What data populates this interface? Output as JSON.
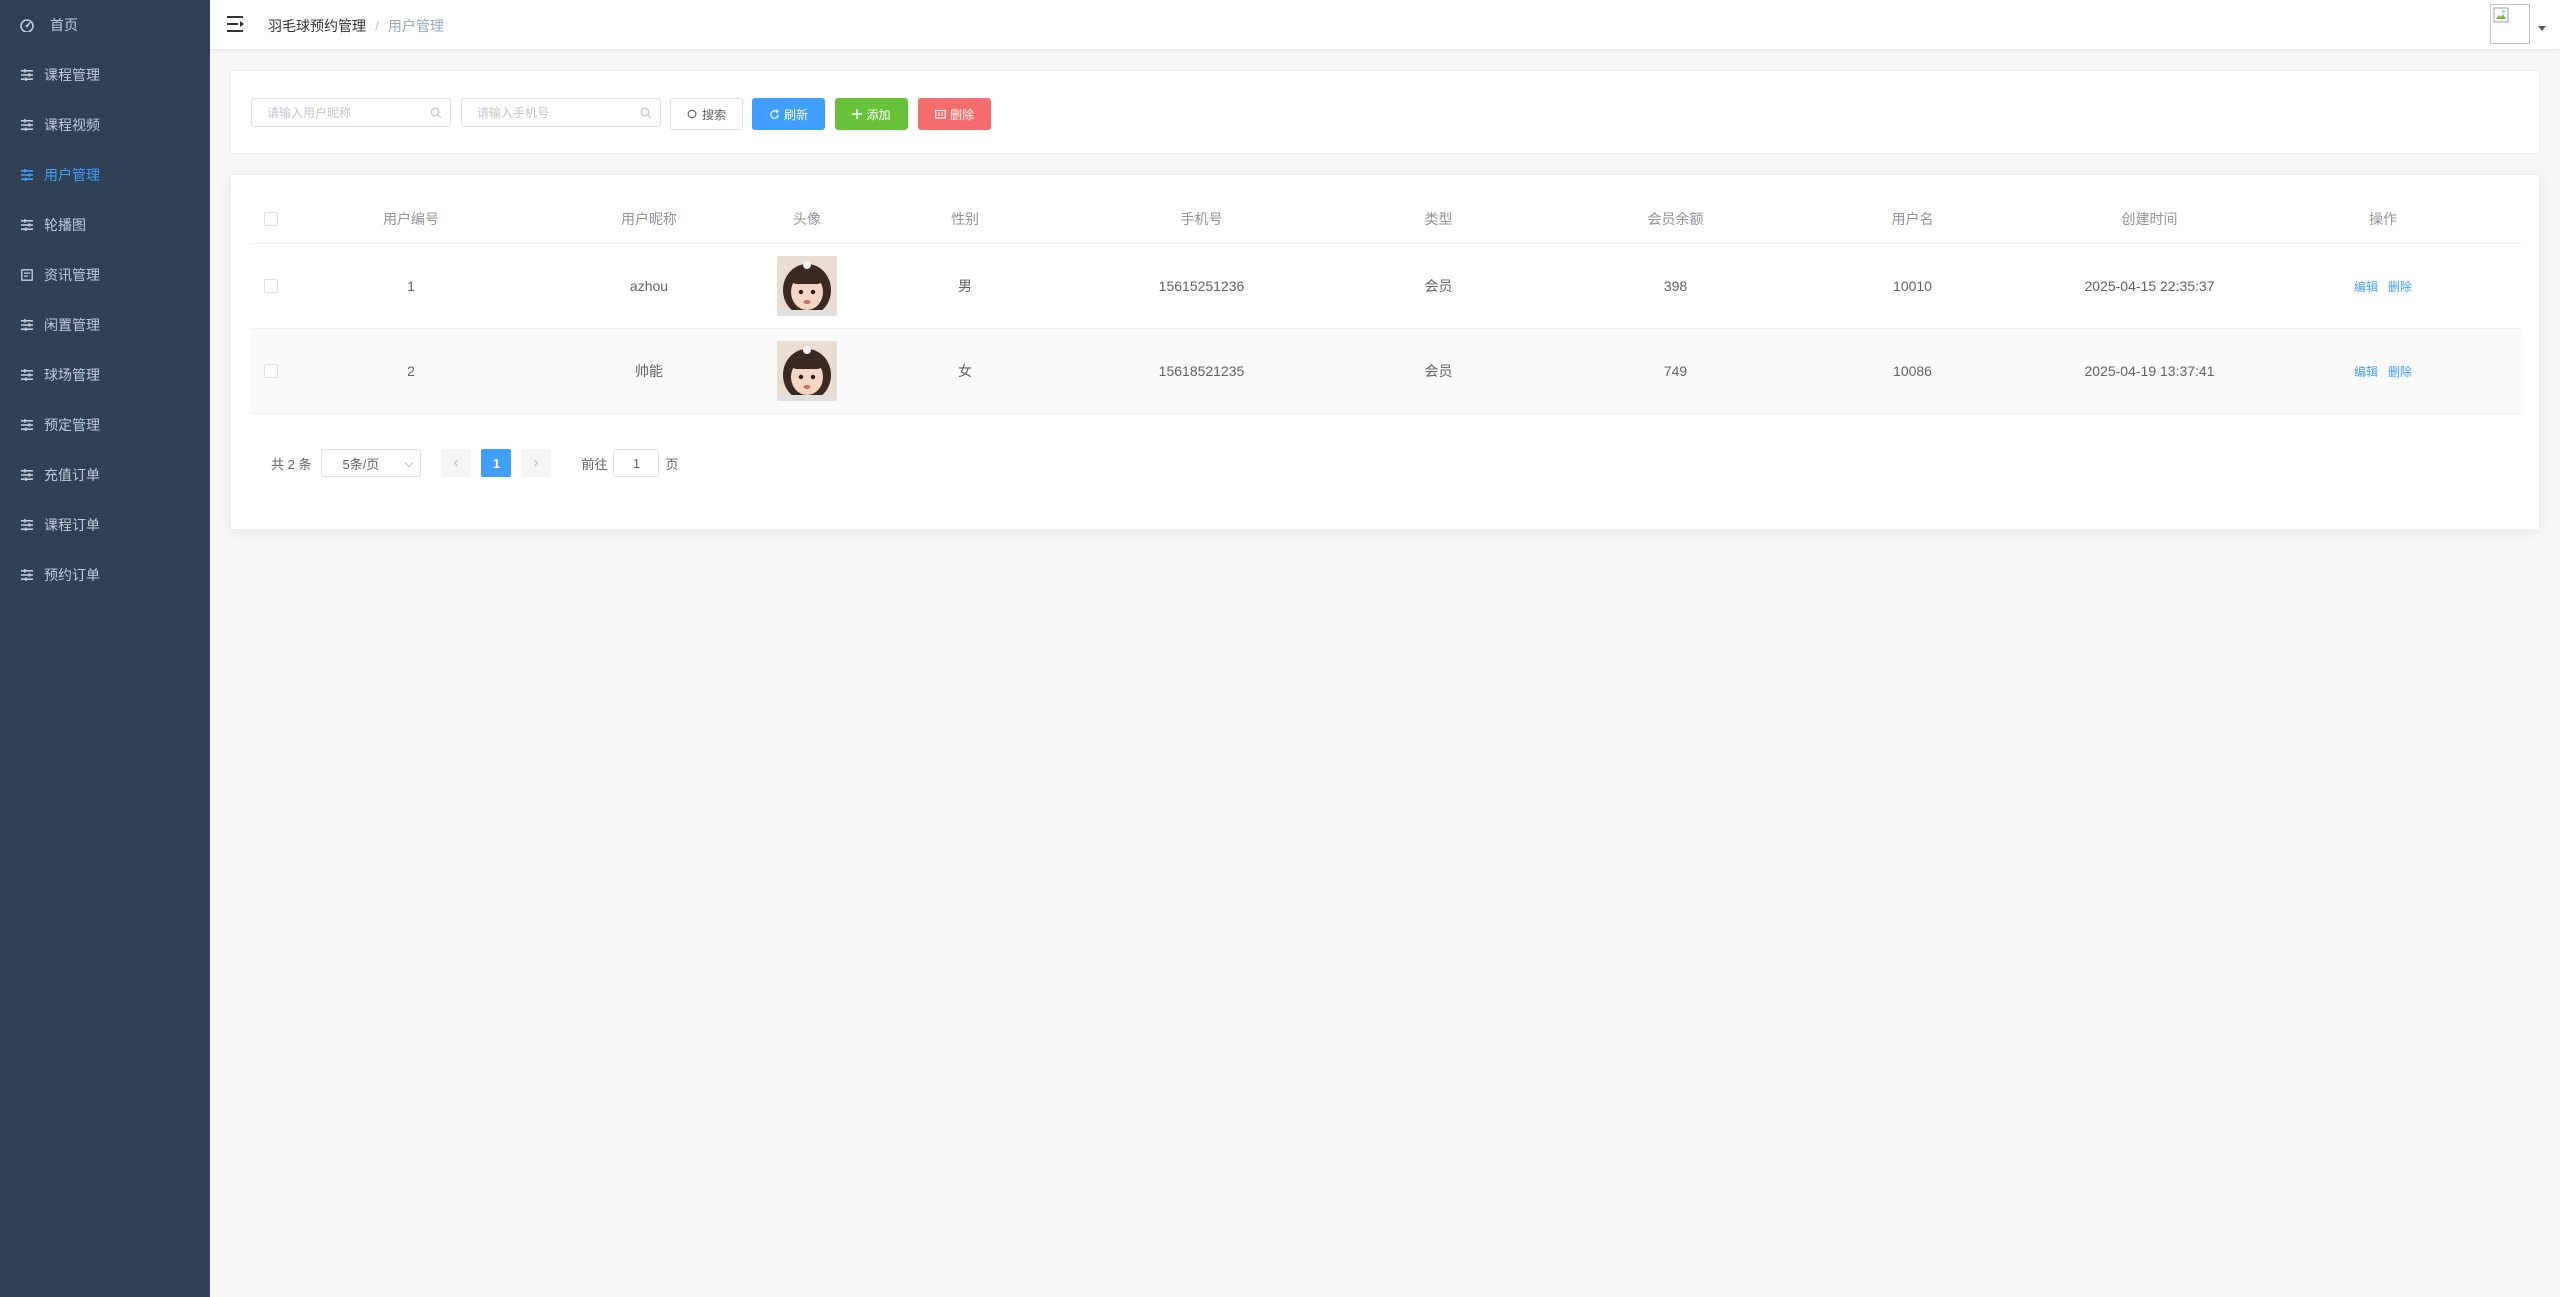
{
  "sidebar": {
    "items": [
      {
        "label": "首页",
        "icon": "dashboard-icon",
        "active": false
      },
      {
        "label": "课程管理",
        "icon": "menu-lines-icon",
        "active": false
      },
      {
        "label": "课程视频",
        "icon": "menu-lines-icon",
        "active": false
      },
      {
        "label": "用户管理",
        "icon": "menu-lines-icon",
        "active": true
      },
      {
        "label": "轮播图",
        "icon": "menu-lines-icon",
        "active": false
      },
      {
        "label": "资讯管理",
        "icon": "document-icon",
        "active": false
      },
      {
        "label": "闲置管理",
        "icon": "menu-lines-icon",
        "active": false
      },
      {
        "label": "球场管理",
        "icon": "menu-lines-icon",
        "active": false
      },
      {
        "label": "预定管理",
        "icon": "menu-lines-icon",
        "active": false
      },
      {
        "label": "充值订单",
        "icon": "menu-lines-icon",
        "active": false
      },
      {
        "label": "课程订单",
        "icon": "menu-lines-icon",
        "active": false
      },
      {
        "label": "预约订单",
        "icon": "menu-lines-icon",
        "active": false
      }
    ]
  },
  "header": {
    "breadcrumb_home": "羽毛球预约管理",
    "breadcrumb_sep": "/",
    "breadcrumb_current": "用户管理"
  },
  "search": {
    "nickname_placeholder": "请输入用户昵称",
    "phone_placeholder": "请输入手机号",
    "search_label": "搜索",
    "refresh_label": "刷新",
    "add_label": "添加",
    "delete_label": "删除"
  },
  "table": {
    "headers": [
      "用户编号",
      "用户昵称",
      "头像",
      "性别",
      "手机号",
      "类型",
      "会员余额",
      "用户名",
      "创建时间",
      "操作"
    ],
    "rows": [
      {
        "id": "1",
        "nickname": "azhou",
        "sex": "男",
        "phone": "15615251236",
        "type": "会员",
        "balance": "398",
        "username": "10010",
        "created": "2025-04-15 22:35:37",
        "edit": "编辑",
        "del": "删除"
      },
      {
        "id": "2",
        "nickname": "帅能",
        "sex": "女",
        "phone": "15618521235",
        "type": "会员",
        "balance": "749",
        "username": "10086",
        "created": "2025-04-19 13:37:41",
        "edit": "编辑",
        "del": "删除"
      }
    ]
  },
  "pagination": {
    "total": "共 2 条",
    "page_size": "5条/页",
    "current_page": "1",
    "goto_prefix": "前往",
    "goto_value": "1",
    "goto_suffix": "页"
  },
  "colors": {
    "sidebar_bg": "#304156",
    "accent": "#409eff",
    "success": "#67c23a",
    "danger": "#f56c6c"
  }
}
